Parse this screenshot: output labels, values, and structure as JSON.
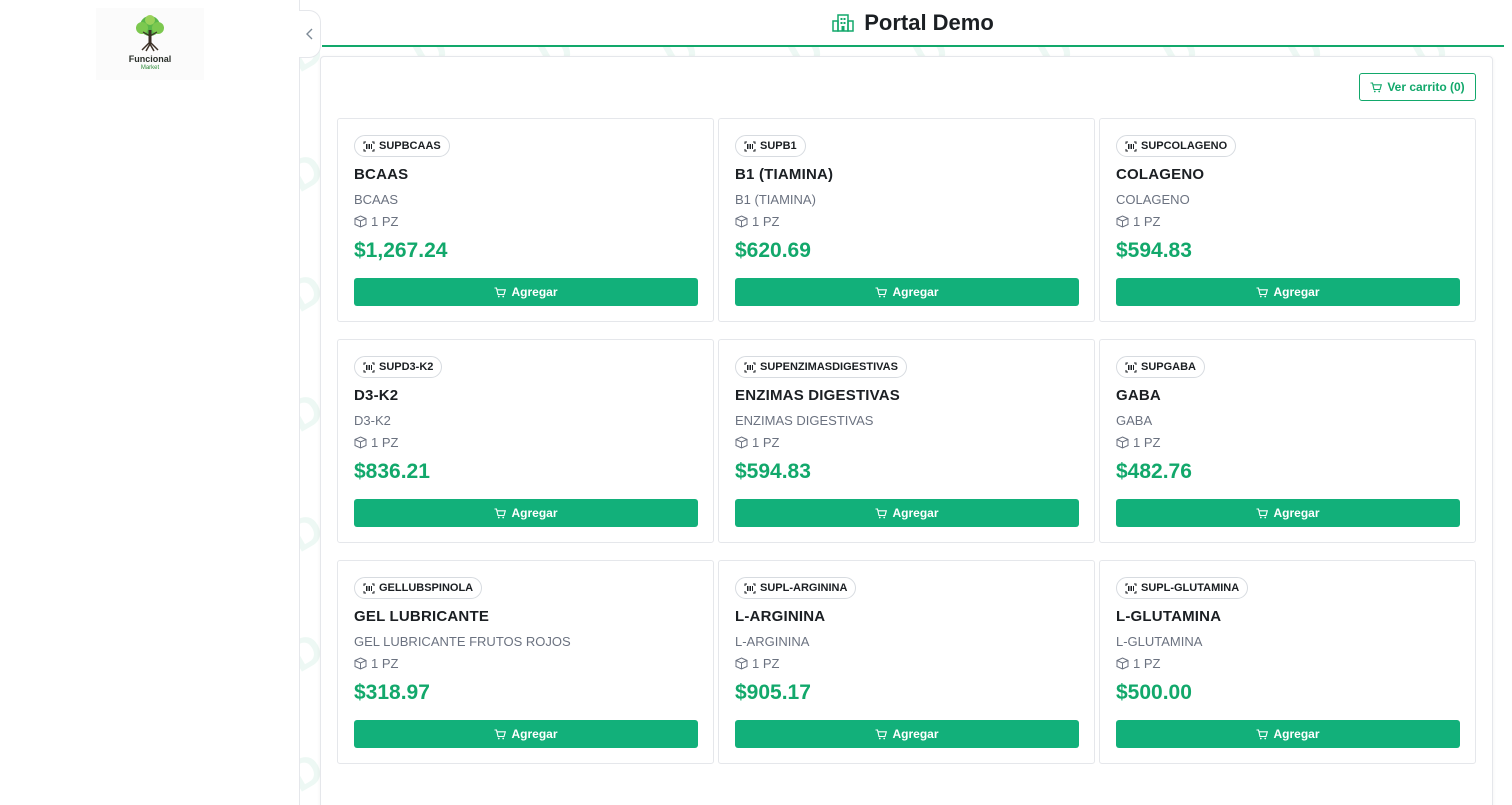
{
  "sidebar": {
    "logo_text": "Funcional",
    "logo_sub": "Market"
  },
  "header": {
    "title": "Portal Demo",
    "icon": "building-icon"
  },
  "toolbar": {
    "cart_label": "Ver carrito (0)"
  },
  "products": [
    {
      "sku": "SUPBCAAS",
      "name": "BCAAS",
      "desc": "BCAAS",
      "unit": "1 PZ",
      "price": "$1,267.24",
      "add_label": "Agregar"
    },
    {
      "sku": "SUPB1",
      "name": "B1 (TIAMINA)",
      "desc": "B1 (TIAMINA)",
      "unit": "1 PZ",
      "price": "$620.69",
      "add_label": "Agregar"
    },
    {
      "sku": "SUPCOLAGENO",
      "name": "COLAGENO",
      "desc": "COLAGENO",
      "unit": "1 PZ",
      "price": "$594.83",
      "add_label": "Agregar"
    },
    {
      "sku": "SUPD3-K2",
      "name": "D3-K2",
      "desc": "D3-K2",
      "unit": "1 PZ",
      "price": "$836.21",
      "add_label": "Agregar"
    },
    {
      "sku": "SUPENZIMASDIGESTIVAS",
      "name": "ENZIMAS DIGESTIVAS",
      "desc": "ENZIMAS DIGESTIVAS",
      "unit": "1 PZ",
      "price": "$594.83",
      "add_label": "Agregar"
    },
    {
      "sku": "SUPGABA",
      "name": "GABA",
      "desc": "GABA",
      "unit": "1 PZ",
      "price": "$482.76",
      "add_label": "Agregar"
    },
    {
      "sku": "GELLUBSPINOLA",
      "name": "GEL LUBRICANTE",
      "desc": "GEL LUBRICANTE FRUTOS ROJOS",
      "unit": "1 PZ",
      "price": "$318.97",
      "add_label": "Agregar"
    },
    {
      "sku": "SUPL-ARGININA",
      "name": "L-ARGININA",
      "desc": "L-ARGININA",
      "unit": "1 PZ",
      "price": "$905.17",
      "add_label": "Agregar"
    },
    {
      "sku": "SUPL-GLUTAMINA",
      "name": "L-GLUTAMINA",
      "desc": "L-GLUTAMINA",
      "unit": "1 PZ",
      "price": "$500.00",
      "add_label": "Agregar"
    }
  ],
  "colors": {
    "accent": "#12a86b",
    "button": "#12b07a"
  }
}
